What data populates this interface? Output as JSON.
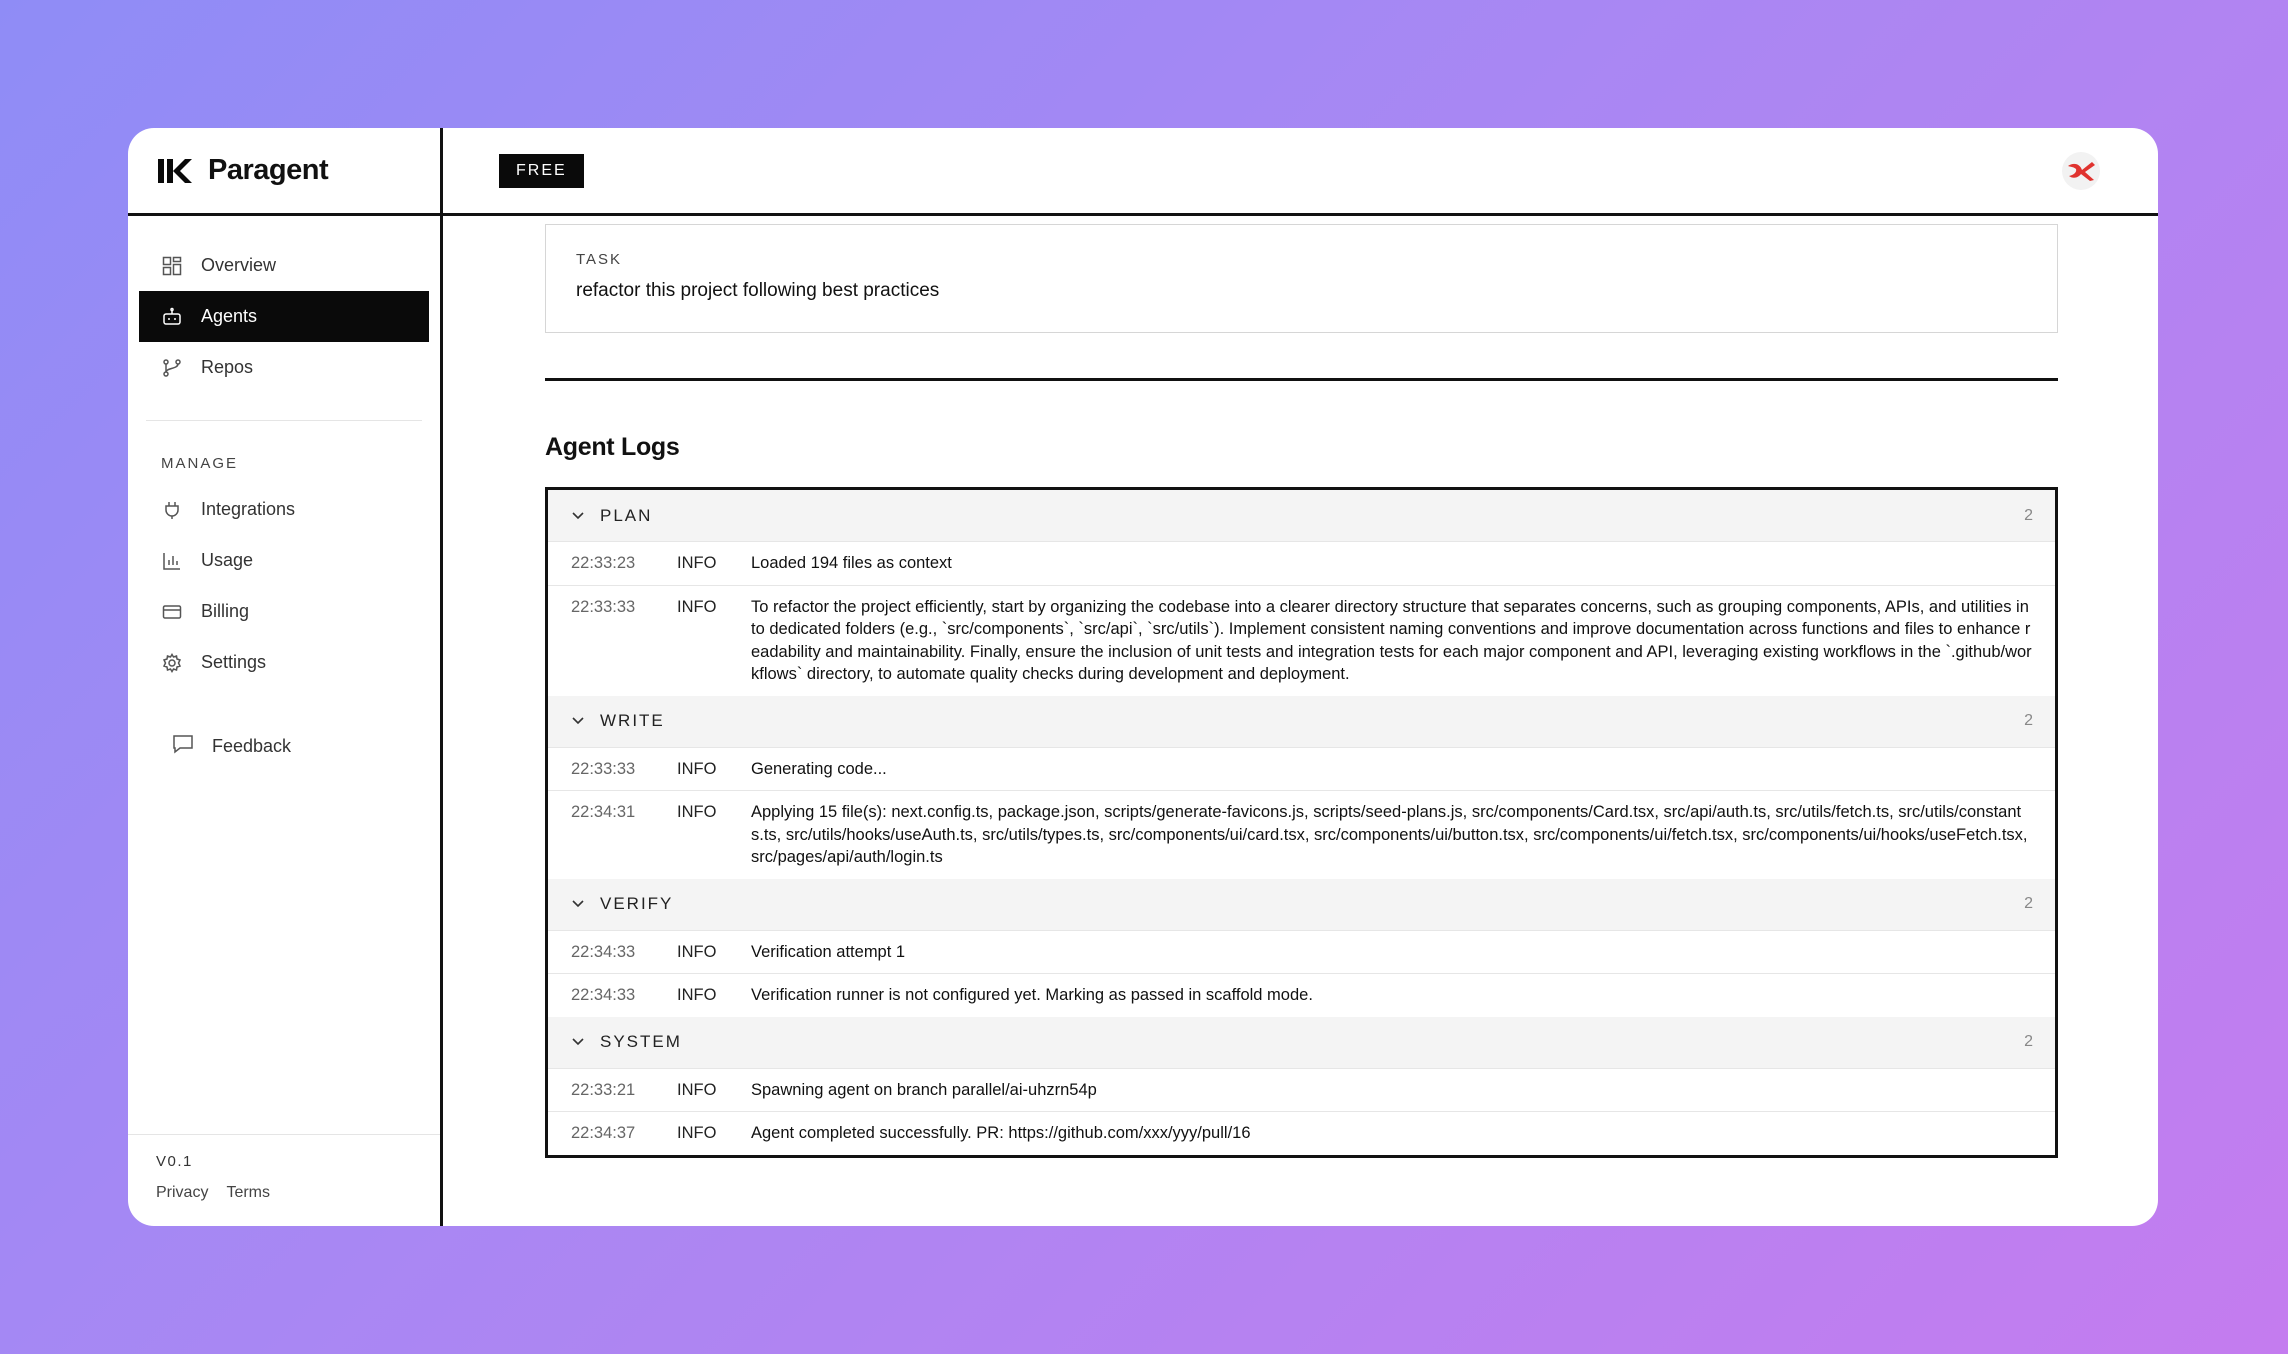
{
  "app": {
    "name": "Paragent",
    "plan_badge": "FREE",
    "version": "V0.1"
  },
  "sidebar": {
    "nav": [
      {
        "label": "Overview",
        "icon": "grid-icon",
        "active": false
      },
      {
        "label": "Agents",
        "icon": "robot-icon",
        "active": true
      },
      {
        "label": "Repos",
        "icon": "branch-icon",
        "active": false
      }
    ],
    "manage_label": "MANAGE",
    "manage": [
      {
        "label": "Integrations",
        "icon": "plug-icon"
      },
      {
        "label": "Usage",
        "icon": "bar-chart-icon"
      },
      {
        "label": "Billing",
        "icon": "credit-card-icon"
      },
      {
        "label": "Settings",
        "icon": "gear-icon"
      }
    ],
    "feedback": "Feedback",
    "footer_links": [
      "Privacy",
      "Terms"
    ]
  },
  "task": {
    "label": "TASK",
    "text": "refactor this project following best practices"
  },
  "logs_title": "Agent Logs",
  "log_groups": [
    {
      "name": "PLAN",
      "count": "2",
      "rows": [
        {
          "time": "22:33:23",
          "level": "INFO",
          "message": "Loaded 194 files as context"
        },
        {
          "time": "22:33:33",
          "level": "INFO",
          "message": "To refactor the project efficiently, start by organizing the codebase into a clearer directory structure that separates concerns, such as grouping components, APIs, and utilities into dedicated folders (e.g., `src/components`, `src/api`, `src/utils`). Implement consistent naming conventions and improve documentation across functions and files to enhance readability and maintainability. Finally, ensure the inclusion of unit tests and integration tests for each major component and API, leveraging existing workflows in the `.github/workflows` directory, to automate quality checks during development and deployment."
        }
      ]
    },
    {
      "name": "WRITE",
      "count": "2",
      "rows": [
        {
          "time": "22:33:33",
          "level": "INFO",
          "message": "Generating code..."
        },
        {
          "time": "22:34:31",
          "level": "INFO",
          "message": "Applying 15 file(s): next.config.ts, package.json, scripts/generate-favicons.js, scripts/seed-plans.js, src/components/Card.tsx, src/api/auth.ts, src/utils/fetch.ts, src/utils/constants.ts, src/utils/hooks/useAuth.ts, src/utils/types.ts, src/components/ui/card.tsx, src/components/ui/button.tsx, src/components/ui/fetch.tsx, src/components/ui/hooks/useFetch.tsx, src/pages/api/auth/login.ts"
        }
      ]
    },
    {
      "name": "VERIFY",
      "count": "2",
      "rows": [
        {
          "time": "22:34:33",
          "level": "INFO",
          "message": "Verification attempt 1"
        },
        {
          "time": "22:34:33",
          "level": "INFO",
          "message": "Verification runner is not configured yet. Marking as passed in scaffold mode."
        }
      ]
    },
    {
      "name": "SYSTEM",
      "count": "2",
      "rows": [
        {
          "time": "22:33:21",
          "level": "INFO",
          "message": "Spawning agent on branch parallel/ai-uhzrn54p"
        },
        {
          "time": "22:34:37",
          "level": "INFO",
          "message": "Agent completed successfully. PR: https://github.com/xxx/yyy/pull/16"
        }
      ]
    }
  ],
  "colors": {
    "accent": "#0a0a0a",
    "avatar_logo": "#e0332f",
    "background_start": "#8f8cf6",
    "background_end": "#c47cef"
  }
}
